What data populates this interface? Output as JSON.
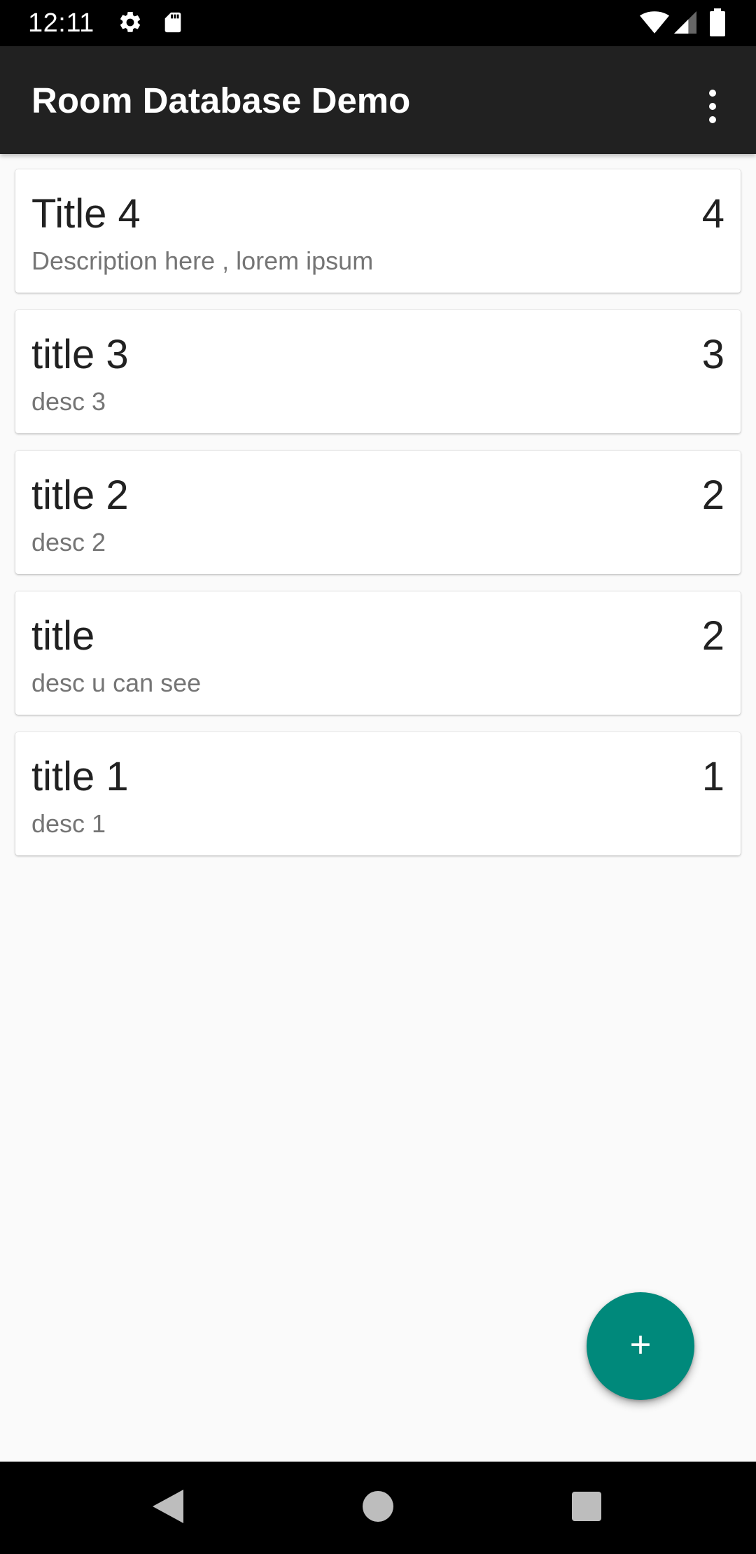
{
  "status_bar": {
    "time": "12:11",
    "icons": [
      "gear-icon",
      "sd-card-icon",
      "wifi-icon",
      "cellular-signal-icon",
      "battery-icon"
    ]
  },
  "app_bar": {
    "title": "Room Database Demo",
    "overflow_icon": "more-vert-icon"
  },
  "notes": [
    {
      "title": "Title 4",
      "description": "Description here , lorem ipsum",
      "priority": "4"
    },
    {
      "title": "title 3",
      "description": "desc 3",
      "priority": "3"
    },
    {
      "title": "title 2",
      "description": "desc 2",
      "priority": "2"
    },
    {
      "title": "title",
      "description": "desc u can see",
      "priority": "2"
    },
    {
      "title": "title 1",
      "description": "desc 1",
      "priority": "1"
    }
  ],
  "fab": {
    "icon": "plus-icon",
    "color": "#00897b"
  },
  "nav_bar": {
    "icons": [
      "back-icon",
      "home-icon",
      "recents-icon"
    ]
  },
  "colors": {
    "app_bar": "#212121",
    "accent": "#00897b",
    "background": "#fafafa"
  }
}
